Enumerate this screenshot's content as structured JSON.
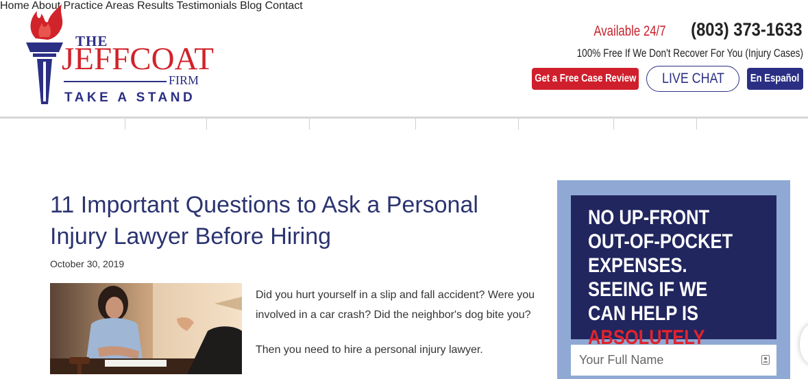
{
  "brand": {
    "the": "THE",
    "name": "JEFFCOAT",
    "firm": "FIRM",
    "tagline": "TAKE A STAND",
    "colors": {
      "red": "#d01f2c",
      "navy": "#2b2f83"
    }
  },
  "header": {
    "availability": "Available 24/7",
    "phone": "(803) 373-1633",
    "guarantee": "100% Free If We Don't Recover For You (Injury Cases)",
    "buttons": {
      "case_review": "Get a Free Case Review",
      "live_chat": "LIVE CHAT",
      "espanol": "En Español"
    }
  },
  "nav": {
    "items": [
      "Home",
      "About",
      "Practice Areas",
      "Results",
      "Testimonials",
      "Blog",
      "Contact"
    ]
  },
  "article": {
    "title": "11 Important Questions to Ask a Personal Injury Lawyer Before Hiring",
    "date": "October 30, 2019",
    "paragraphs": [
      "Did you hurt yourself in a slip and fall accident? Were you involved in a car crash? Did the neighbor's dog bite you?",
      "Then you need to hire a personal injury lawyer."
    ]
  },
  "sidebar": {
    "headline_main": "NO UP-FRONT OUT-OF-POCKET EXPENSES. SEEING IF WE CAN HELP IS",
    "headline_highlight": "ABSOLUTELY FREE",
    "headline_end": ".",
    "name_placeholder": "Your Full Name",
    "icon": "contact-card-icon"
  }
}
